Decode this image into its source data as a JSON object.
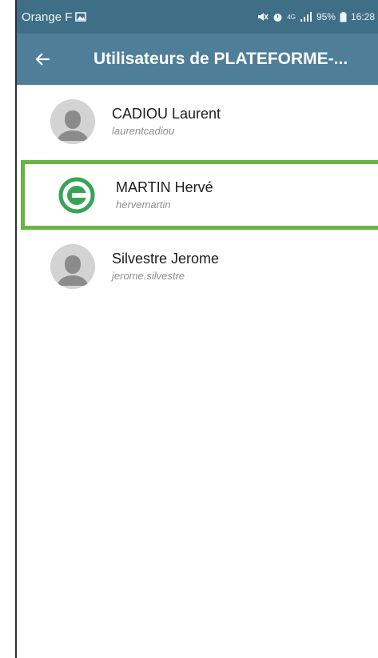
{
  "status_bar": {
    "carrier": "Orange F",
    "signal_text": "4G",
    "battery": "95%",
    "time": "16:28"
  },
  "app_bar": {
    "title": "Utilisateurs de PLATEFORME-..."
  },
  "users": [
    {
      "name": "CADIOU Laurent",
      "login": "laurentcadiou",
      "avatar": "default-person-icon",
      "selected": false
    },
    {
      "name": "MARTIN Hervé",
      "login": "hervemartin",
      "avatar": "app-logo-icon",
      "selected": true
    },
    {
      "name": "Silvestre Jerome",
      "login": "jerome.silvestre",
      "avatar": "default-person-icon",
      "selected": false
    }
  ],
  "colors": {
    "status_bar": "#3f6f87",
    "app_bar": "#4e7e98",
    "highlight": "#69b445",
    "logo": "#36a457"
  }
}
